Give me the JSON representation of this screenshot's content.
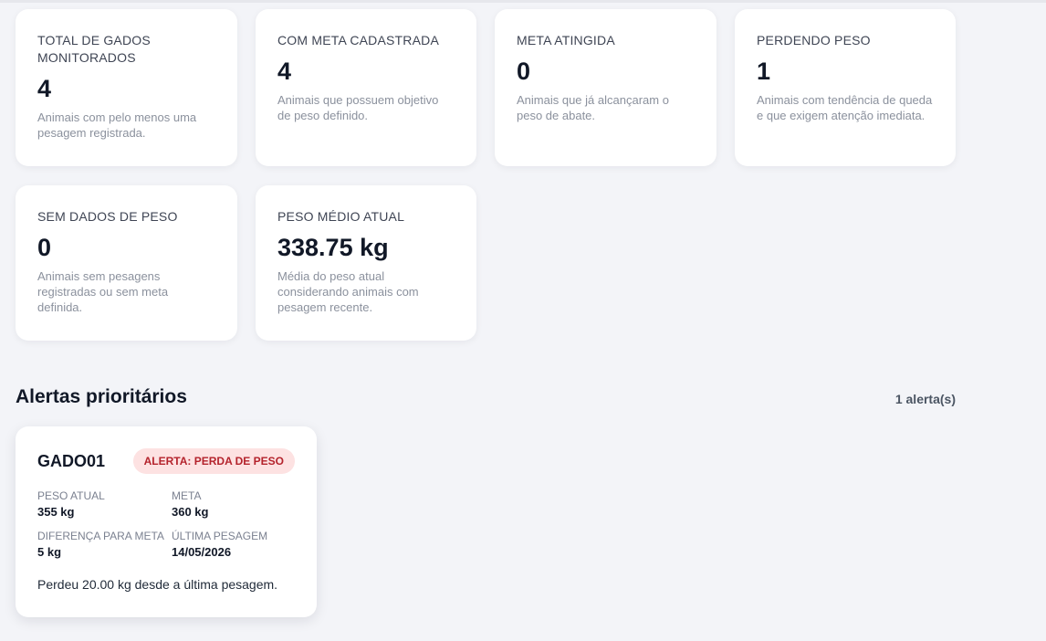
{
  "summary_cards": [
    {
      "label": "TOTAL DE GADOS MONITORADOS",
      "value": "4",
      "description": "Animais com pelo menos uma pesagem registrada."
    },
    {
      "label": "COM META CADASTRADA",
      "value": "4",
      "description": "Animais que possuem objetivo de peso definido."
    },
    {
      "label": "META ATINGIDA",
      "value": "0",
      "description": "Animais que já alcançaram o peso de abate."
    },
    {
      "label": "PERDENDO PESO",
      "value": "1",
      "description": "Animais com tendência de queda e que exigem atenção imediata."
    },
    {
      "label": "SEM DADOS DE PESO",
      "value": "0",
      "description": "Animais sem pesagens registradas ou sem meta definida."
    },
    {
      "label": "PESO MÉDIO ATUAL",
      "value": "338.75 kg",
      "description": "Média do peso atual considerando animais com pesagem recente."
    }
  ],
  "alerts_section": {
    "title": "Alertas prioritários",
    "count": "1 alerta(s)",
    "alerts": [
      {
        "name": "GADO01",
        "badge": "ALERTA: PERDA DE PESO",
        "current_weight_label": "PESO ATUAL",
        "current_weight": "355 kg",
        "goal_label": "META",
        "goal": "360 kg",
        "difference_label": "DIFERENÇA PARA META",
        "difference": "5 kg",
        "last_weighing_label": "ÚLTIMA PESAGEM",
        "last_weighing": "14/05/2026",
        "message": "Perdeu 20.00 kg desde a última pesagem."
      }
    ]
  },
  "colors": {
    "background": "#f3f4f8",
    "card": "#ffffff",
    "alert_badge_bg": "#fde2e2",
    "alert_badge_text": "#b4232c"
  }
}
